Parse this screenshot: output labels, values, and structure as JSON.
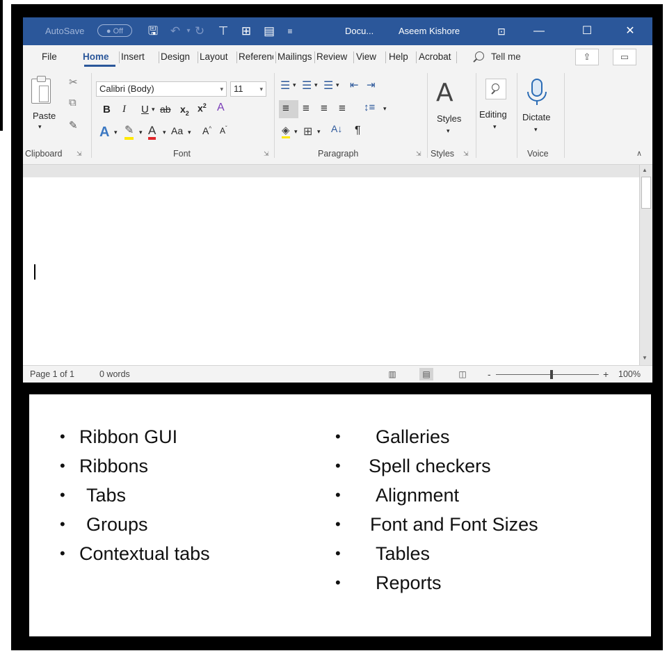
{
  "title_bar": {
    "autosave_label": "AutoSave",
    "autosave_state": "Off",
    "document_title": "Docu...",
    "user_name": "Aseem Kishore",
    "color": "#2b579a"
  },
  "tabs": [
    "File",
    "Home",
    "Insert",
    "Design",
    "Layout",
    "References",
    "Mailings",
    "Review",
    "View",
    "Help",
    "Acrobat"
  ],
  "active_tab": "Home",
  "tell_me": "Tell me",
  "ribbon": {
    "font_name": "Calibri (Body)",
    "font_size": "11",
    "paste_label": "Paste",
    "styles_label": "Styles",
    "editing_label": "Editing",
    "dictate_label": "Dictate",
    "groups": {
      "clipboard": "Clipboard",
      "font": "Font",
      "paragraph": "Paragraph",
      "styles": "Styles",
      "voice": "Voice"
    }
  },
  "status_bar": {
    "page": "Page 1 of 1",
    "words": "0 words",
    "zoom": "100%",
    "zoom_minus": "-",
    "zoom_plus": "+"
  },
  "list_left": [
    "Ribbon GUI",
    "Ribbons",
    "Tabs",
    "Groups",
    "Contextual tabs"
  ],
  "list_right": [
    "Galleries",
    "Spell checkers",
    "Alignment",
    "Font and Font Sizes",
    "Tables",
    "Reports"
  ],
  "bullet": "•"
}
